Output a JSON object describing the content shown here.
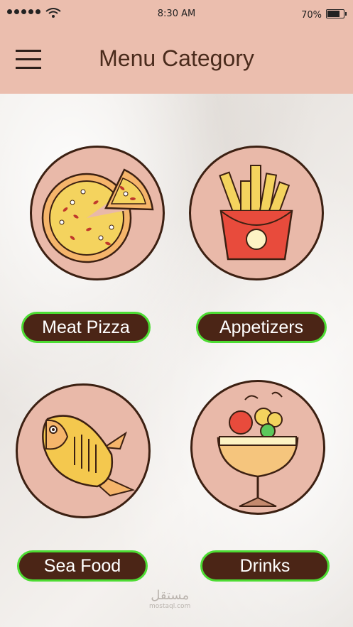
{
  "status_bar": {
    "time": "8:30 AM",
    "battery": "70%",
    "battery_level": 0.7
  },
  "header": {
    "title": "Menu Category"
  },
  "categories": [
    {
      "label": "Meat Pizza",
      "icon": "pizza-icon"
    },
    {
      "label": "Appetizers",
      "icon": "fries-icon"
    },
    {
      "label": "Sea Food",
      "icon": "fish-icon"
    },
    {
      "label": "Drinks",
      "icon": "cocktail-icon"
    }
  ],
  "colors": {
    "header_bg": "#ebbeae",
    "circle_bg": "#e9b9a9",
    "pill_bg": "#4b2516",
    "pill_border": "#4ddc33",
    "title": "#4a2b1c"
  },
  "watermark": {
    "text": "مستقل",
    "sub": "mostaql.com"
  }
}
